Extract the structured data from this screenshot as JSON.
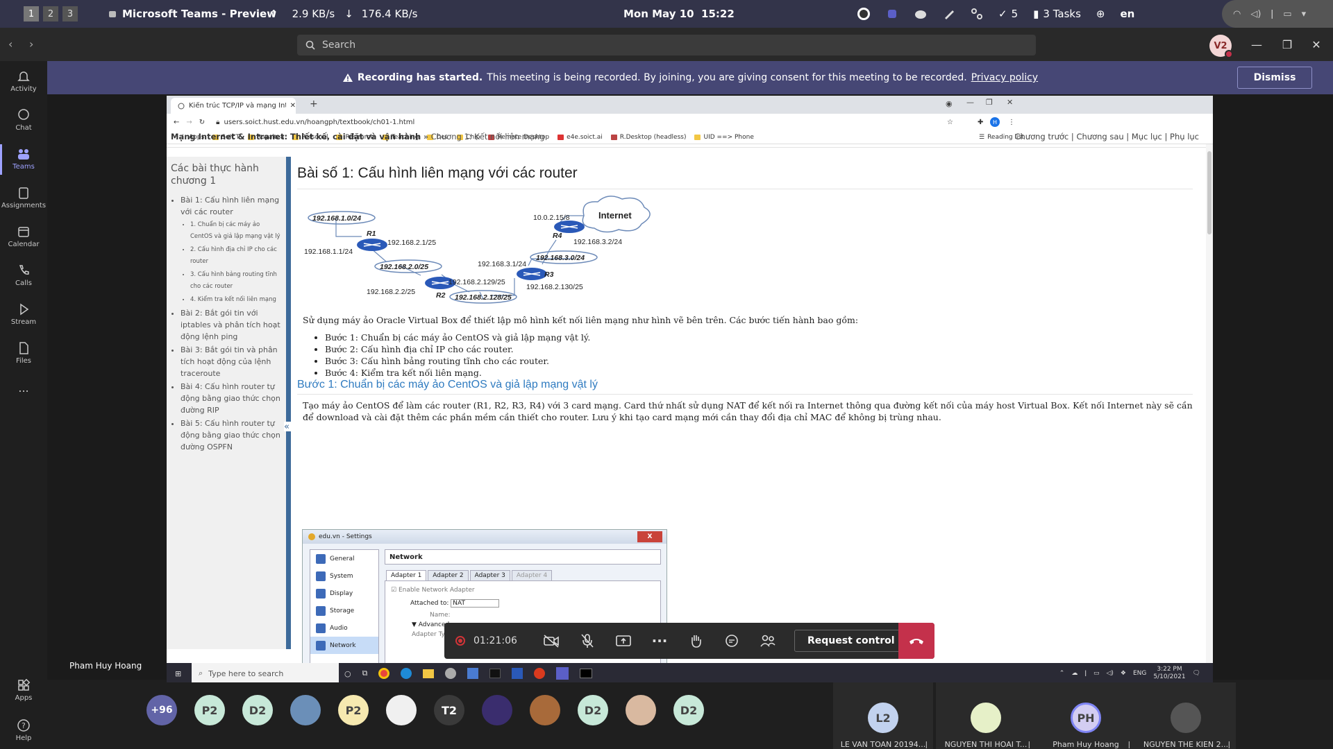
{
  "sysbar": {
    "workspaces": [
      "1",
      "2",
      "3"
    ],
    "app_title": "Microsoft Teams - Preview",
    "upload": "2.9 KB/s",
    "download": "176.4 KB/s",
    "datetime": "Mon May 10  15:22",
    "check_count": "5",
    "tasks": "3 Tasks",
    "lang": "en"
  },
  "titlebar": {
    "search_placeholder": "Search",
    "me_initials": "V2"
  },
  "rail": {
    "items": [
      {
        "label": "Activity",
        "icon": "bell-icon"
      },
      {
        "label": "Chat",
        "icon": "chat-icon"
      },
      {
        "label": "Teams",
        "icon": "teams-icon"
      },
      {
        "label": "Assignments",
        "icon": "assignments-icon"
      },
      {
        "label": "Calendar",
        "icon": "calendar-icon"
      },
      {
        "label": "Calls",
        "icon": "phone-icon"
      },
      {
        "label": "Stream",
        "icon": "stream-icon"
      },
      {
        "label": "Files",
        "icon": "file-icon"
      }
    ],
    "more": "...",
    "apps": "Apps",
    "help": "Help"
  },
  "banner": {
    "bold": "Recording has started.",
    "text": "This meeting is being recorded. By joining, you are giving consent for this meeting to be recorded.",
    "link": "Privacy policy",
    "dismiss": "Dismiss"
  },
  "browser": {
    "tab_title": "Kiến trúc TCP/IP và mạng Intrane",
    "url": "users.soict.hust.edu.vn/hoangph/textbook/ch01-1.html",
    "bookmarks": [
      "Apps",
      "SoICT",
      "Royaltea",
      "Personal",
      "Research",
      "Teaching",
      "Dev",
      "Chip",
      "Remote Desktop",
      "e4e.soict.ai",
      "R.Desktop (headless)",
      "UID ==> Phone"
    ],
    "reading_list": "Reading list"
  },
  "page": {
    "crumb_main": "Mạng Internet & Intranet: Thiết kế, cài đặt và vận hành",
    "crumb_sep": " » ",
    "crumb_sub": "Chương 1: Kết nối liên mạng",
    "toplinks": "Chương trước | Chương sau | Mục lục | Phụ lục",
    "toc_title": "Các bài thực hành chương 1",
    "toc": [
      {
        "t": "Bài 1: Cấu hình liên mạng với các router",
        "sub": false
      },
      {
        "t": "1. Chuẩn bị các máy ảo CentOS và giả lập mạng vật lý",
        "sub": true
      },
      {
        "t": "2. Cấu hình địa chỉ IP cho các router",
        "sub": true
      },
      {
        "t": "3. Cấu hình bảng routing tĩnh cho các router",
        "sub": true
      },
      {
        "t": "4. Kiểm tra kết nối liên mạng",
        "sub": true
      },
      {
        "t": "Bài 2: Bắt gói tin với iptables và phân tích hoạt động lệnh ping",
        "sub": false
      },
      {
        "t": "Bài 3: Bắt gói tin và phân tích hoạt động của lệnh traceroute",
        "sub": false
      },
      {
        "t": "Bài 4: Cấu hình router tự động bằng giao thức chọn đường RIP",
        "sub": false
      },
      {
        "t": "Bài 5: Cấu hình router tự động bằng giao thức chọn đường OSPFN",
        "sub": false
      }
    ],
    "h1": "Bài số 1: Cấu hình liên mạng với các router",
    "diagram": {
      "internet": "Internet",
      "nets": [
        "192.168.1.0/24",
        "192.168.2.0/25",
        "192.168.2.128/25",
        "192.168.3.0/24"
      ],
      "routers": [
        "R1",
        "R2",
        "R3",
        "R4"
      ],
      "ips": [
        "192.168.1.1/24",
        "192.168.2.1/25",
        "192.168.2.2/25",
        "192.168.2.129/25",
        "192.168.3.1/24",
        "192.168.2.130/25",
        "10.0.2.15/8",
        "192.168.3.2/24"
      ]
    },
    "lead": "Sử dụng máy ảo Oracle Virtual Box để thiết lập mô hình kết nối liên mạng như hình vẽ bên trên. Các bước tiến hành bao gồm:",
    "steps": [
      "Bước 1: Chuẩn bị các máy ảo CentOS và giả lập mạng vật lý.",
      "Bước 2: Cấu hình địa chỉ IP cho các router.",
      "Bước 3: Cấu hình bảng routing tĩnh cho các router.",
      "Bước 4: Kiểm tra kết nối liên mạng."
    ],
    "h2": "Bước 1: Chuẩn bị các máy ảo CentOS và giả lập mạng vật lý",
    "para": "Tạo máy ảo CentOS để làm các router (R1, R2, R3, R4) với 3 card mạng. Card thứ nhất sử dụng NAT để kết nối ra Internet thông qua đường kết nối của máy host Virtual Box. Kết nối Internet này sẽ cần để download và cài đặt thêm các phần mềm cần thiết cho router. Lưu ý khi tạo card mạng mới cần thay đổi địa chỉ MAC để không bị trùng nhau."
  },
  "vbox": {
    "title": "edu.vn - Settings",
    "close": "X",
    "menu": [
      "General",
      "System",
      "Display",
      "Storage",
      "Audio",
      "Network"
    ],
    "header": "Network",
    "tabs": [
      "Adapter 1",
      "Adapter 2",
      "Adapter 3",
      "Adapter 4"
    ],
    "enable": "Enable Network Adapter",
    "attached_label": "Attached to:",
    "attached_value": "NAT",
    "advanced": "Advanced",
    "name_label": "Name:",
    "adapter_type": "Adapter Type:"
  },
  "call": {
    "timer": "01:21:06",
    "request_control": "Request control"
  },
  "wintask": {
    "search": "Type here to search",
    "lang": "ENG",
    "time": "3:22 PM",
    "date": "5/10/2021"
  },
  "presenter": "Pham Huy Hoang",
  "roster": {
    "more": "+96",
    "avatars": [
      {
        "t": "P2",
        "bg": "#c7e8d8"
      },
      {
        "t": "D2",
        "bg": "#c7e8d8"
      },
      {
        "t": "",
        "bg": "#6b8fb8"
      },
      {
        "t": "P2",
        "bg": "#f6e9b0"
      },
      {
        "t": "",
        "bg": "#f0f0f0"
      },
      {
        "t": "T2",
        "bg": "#3a3a3a"
      },
      {
        "t": "",
        "bg": "#3a2d6e"
      },
      {
        "t": "",
        "bg": "#a86a3a"
      },
      {
        "t": "D2",
        "bg": "#c7e8d8"
      },
      {
        "t": "",
        "bg": "#d9b9a0"
      },
      {
        "t": "D2",
        "bg": "#c7e8d8"
      }
    ],
    "tiles": [
      {
        "name": "LE VAN TOAN 20194...",
        "init": "L2",
        "bg": "#c2d2ee"
      },
      {
        "name": "NGUYEN THI HOAI T...",
        "init": "",
        "bg": "#e6f0c8"
      },
      {
        "name": "Pham Huy Hoang",
        "init": "PH",
        "bg": "#d3cdf2"
      },
      {
        "name": "NGUYEN THE KIEN 2...",
        "init": "",
        "bg": "#555"
      }
    ]
  }
}
